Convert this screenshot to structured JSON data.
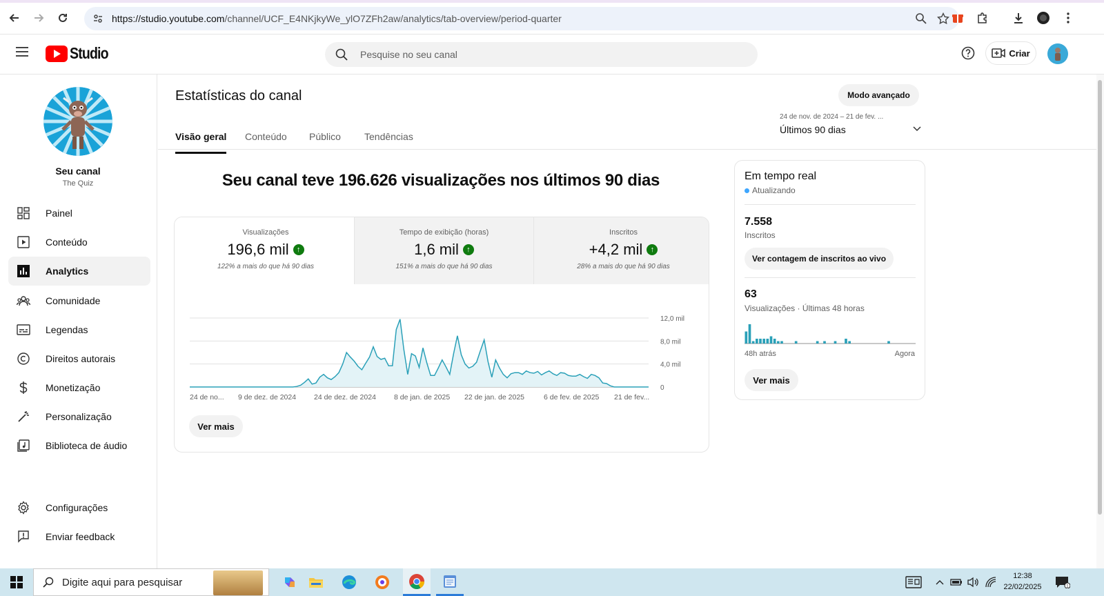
{
  "browser": {
    "url_host": "https://studio.youtube.com",
    "url_path": "/channel/UCF_E4NKjkyWe_ylO7ZFh2aw/analytics/tab-overview/period-quarter"
  },
  "header": {
    "logo_text": "Studio",
    "search_placeholder": "Pesquise no seu canal",
    "create_label": "Criar"
  },
  "sidebar": {
    "channel_title": "Seu canal",
    "channel_name": "The Quiz",
    "items": [
      {
        "label": "Painel",
        "icon": "dashboard-icon"
      },
      {
        "label": "Conteúdo",
        "icon": "content-icon"
      },
      {
        "label": "Analytics",
        "icon": "analytics-icon"
      },
      {
        "label": "Comunidade",
        "icon": "community-icon"
      },
      {
        "label": "Legendas",
        "icon": "subtitles-icon"
      },
      {
        "label": "Direitos autorais",
        "icon": "copyright-icon"
      },
      {
        "label": "Monetização",
        "icon": "dollar-icon"
      },
      {
        "label": "Personalização",
        "icon": "wand-icon"
      },
      {
        "label": "Biblioteca de áudio",
        "icon": "audio-library-icon"
      }
    ],
    "settings_label": "Configurações",
    "feedback_label": "Enviar feedback"
  },
  "main": {
    "page_title": "Estatísticas do canal",
    "advanced_mode": "Modo avançado",
    "tabs": [
      "Visão geral",
      "Conteúdo",
      "Público",
      "Tendências"
    ],
    "date_range": "24 de nov. de 2024 – 21 de fev. ...",
    "period_label": "Últimos 90 dias",
    "headline": "Seu canal teve 196.626 visualizações nos últimos 90 dias",
    "metrics": [
      {
        "title": "Visualizações",
        "value": "196,6 mil",
        "sub": "122% a mais do que há 90 dias"
      },
      {
        "title": "Tempo de exibição (horas)",
        "value": "1,6 mil",
        "sub": "151% a mais do que há 90 dias"
      },
      {
        "title": "Inscritos",
        "value": "+4,2 mil",
        "sub": "28% a mais do que há 90 dias"
      }
    ],
    "see_more": "Ver mais"
  },
  "chart_data": {
    "type": "area",
    "x_labels": [
      "24 de no...",
      "9 de dez. de 2024",
      "24 de dez. de 2024",
      "8 de jan. de 2025",
      "22 de jan. de 2025",
      "6 de fev. de 2025",
      "21 de fev..."
    ],
    "y_ticks": [
      "12,0 mil",
      "8,0 mil",
      "4,0 mil",
      "0"
    ],
    "ylim": [
      0,
      12000
    ],
    "values": [
      0,
      0,
      0,
      0,
      0,
      0,
      0,
      0,
      0,
      0,
      0,
      0,
      0,
      0,
      0,
      0,
      0,
      0,
      0,
      0,
      0,
      0,
      0,
      0,
      0,
      0,
      0,
      0,
      100,
      300,
      800,
      1400,
      500,
      700,
      1700,
      2200,
      1600,
      1300,
      1800,
      2500,
      4000,
      6000,
      5200,
      4500,
      3600,
      3000,
      4100,
      5200,
      7000,
      5300,
      4800,
      5000,
      3700,
      3700,
      10000,
      11800,
      6500,
      2200,
      5800,
      5400,
      3400,
      6800,
      4200,
      2000,
      2000,
      3300,
      4700,
      3500,
      2200,
      5800,
      8900,
      5600,
      4000,
      3300,
      3600,
      4300,
      6300,
      8200,
      4400,
      1700,
      4700,
      3300,
      2200,
      1600,
      2300,
      2500,
      2500,
      2200,
      2800,
      2500,
      2400,
      2700,
      2100,
      2500,
      2800,
      2300,
      2000,
      2500,
      2400,
      2000,
      1900,
      1900,
      2200,
      1800,
      1500,
      2200,
      2000,
      1600,
      700,
      600,
      200,
      0,
      0,
      0,
      0,
      0,
      0,
      0,
      0,
      0,
      0
    ]
  },
  "realtime": {
    "title": "Em tempo real",
    "status": "Atualizando",
    "subscribers_value": "7.558",
    "subscribers_label": "Inscritos",
    "live_count_button": "Ver contagem de inscritos ao vivo",
    "views_value": "63",
    "views_label": "Visualizações · Últimas 48 horas",
    "axis_start": "48h atrás",
    "axis_end": "Agora",
    "see_more": "Ver mais",
    "bars": [
      5,
      8,
      1,
      2,
      2,
      2,
      2,
      3,
      2,
      1,
      1,
      0,
      0,
      0,
      1,
      0,
      0,
      0,
      0,
      0,
      1,
      0,
      1,
      0,
      0,
      1,
      0,
      0,
      2,
      1,
      0,
      0,
      0,
      0,
      0,
      0,
      0,
      0,
      0,
      0,
      1,
      0,
      0,
      0,
      0,
      0,
      0,
      0
    ]
  },
  "taskbar": {
    "search_placeholder": "Digite aqui para pesquisar",
    "time": "12:38",
    "date": "22/02/2025"
  },
  "colors": {
    "youtube_red": "#ff0000",
    "chart_line": "#2aa0b8",
    "chart_fill": "#e3f3f7",
    "positive_green": "#0f7b0f",
    "realtime_dot": "#3ea6ff"
  }
}
